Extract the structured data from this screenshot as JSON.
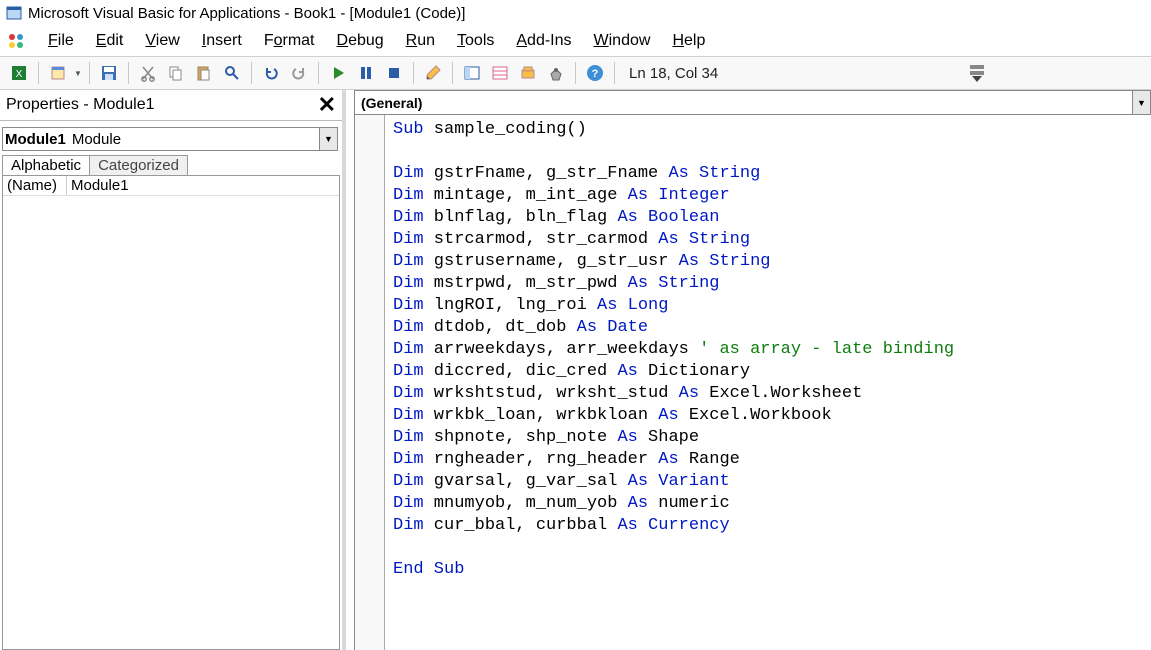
{
  "title": "Microsoft Visual Basic for Applications - Book1 - [Module1 (Code)]",
  "menu": {
    "file": "File",
    "edit": "Edit",
    "view": "View",
    "insert": "Insert",
    "format": "Format",
    "debug": "Debug",
    "run": "Run",
    "tools": "Tools",
    "addins": "Add-Ins",
    "window": "Window",
    "help": "Help"
  },
  "toolbar": {
    "cursor_status": "Ln 18, Col 34"
  },
  "properties": {
    "title": "Properties - Module1",
    "object_name": "Module1",
    "object_type": "Module",
    "tab_alpha": "Alphabetic",
    "tab_cat": "Categorized",
    "rows": [
      {
        "k": "(Name)",
        "v": "Module1"
      }
    ]
  },
  "code_header": {
    "left_combo": "(General)"
  },
  "code_lines": [
    {
      "tokens": [
        {
          "t": "Sub",
          "c": "kw"
        },
        {
          "t": " sample_coding()",
          "c": ""
        }
      ]
    },
    {
      "tokens": []
    },
    {
      "tokens": [
        {
          "t": "Dim",
          "c": "kw"
        },
        {
          "t": " gstrFname, g_str_Fname ",
          "c": ""
        },
        {
          "t": "As String",
          "c": "kw"
        }
      ]
    },
    {
      "tokens": [
        {
          "t": "Dim",
          "c": "kw"
        },
        {
          "t": " mintage, m_int_age ",
          "c": ""
        },
        {
          "t": "As Integer",
          "c": "kw"
        }
      ]
    },
    {
      "tokens": [
        {
          "t": "Dim",
          "c": "kw"
        },
        {
          "t": " blnflag, bln_flag ",
          "c": ""
        },
        {
          "t": "As Boolean",
          "c": "kw"
        }
      ]
    },
    {
      "tokens": [
        {
          "t": "Dim",
          "c": "kw"
        },
        {
          "t": " strcarmod, str_carmod ",
          "c": ""
        },
        {
          "t": "As String",
          "c": "kw"
        }
      ]
    },
    {
      "tokens": [
        {
          "t": "Dim",
          "c": "kw"
        },
        {
          "t": " gstrusername, g_str_usr ",
          "c": ""
        },
        {
          "t": "As String",
          "c": "kw"
        }
      ]
    },
    {
      "tokens": [
        {
          "t": "Dim",
          "c": "kw"
        },
        {
          "t": " mstrpwd, m_str_pwd ",
          "c": ""
        },
        {
          "t": "As String",
          "c": "kw"
        }
      ]
    },
    {
      "tokens": [
        {
          "t": "Dim",
          "c": "kw"
        },
        {
          "t": " lngROI, lng_roi ",
          "c": ""
        },
        {
          "t": "As Long",
          "c": "kw"
        }
      ]
    },
    {
      "tokens": [
        {
          "t": "Dim",
          "c": "kw"
        },
        {
          "t": " dtdob, dt_dob ",
          "c": ""
        },
        {
          "t": "As Date",
          "c": "kw"
        }
      ]
    },
    {
      "tokens": [
        {
          "t": "Dim",
          "c": "kw"
        },
        {
          "t": " arrweekdays, arr_weekdays ",
          "c": ""
        },
        {
          "t": "' as array - late binding",
          "c": "cm"
        }
      ]
    },
    {
      "tokens": [
        {
          "t": "Dim",
          "c": "kw"
        },
        {
          "t": " diccred, dic_cred ",
          "c": ""
        },
        {
          "t": "As",
          "c": "kw"
        },
        {
          "t": " Dictionary",
          "c": ""
        }
      ]
    },
    {
      "tokens": [
        {
          "t": "Dim",
          "c": "kw"
        },
        {
          "t": " wrkshtstud, wrksht_stud ",
          "c": ""
        },
        {
          "t": "As",
          "c": "kw"
        },
        {
          "t": " Excel.Worksheet",
          "c": ""
        }
      ]
    },
    {
      "tokens": [
        {
          "t": "Dim",
          "c": "kw"
        },
        {
          "t": " wrkbk_loan, wrkbkloan ",
          "c": ""
        },
        {
          "t": "As",
          "c": "kw"
        },
        {
          "t": " Excel.Workbook",
          "c": ""
        }
      ]
    },
    {
      "tokens": [
        {
          "t": "Dim",
          "c": "kw"
        },
        {
          "t": " shpnote, shp_note ",
          "c": ""
        },
        {
          "t": "As",
          "c": "kw"
        },
        {
          "t": " Shape",
          "c": ""
        }
      ]
    },
    {
      "tokens": [
        {
          "t": "Dim",
          "c": "kw"
        },
        {
          "t": " rngheader, rng_header ",
          "c": ""
        },
        {
          "t": "As",
          "c": "kw"
        },
        {
          "t": " Range",
          "c": ""
        }
      ]
    },
    {
      "tokens": [
        {
          "t": "Dim",
          "c": "kw"
        },
        {
          "t": " gvarsal, g_var_sal ",
          "c": ""
        },
        {
          "t": "As Variant",
          "c": "kw"
        }
      ]
    },
    {
      "tokens": [
        {
          "t": "Dim",
          "c": "kw"
        },
        {
          "t": " mnumyob, m_num_yob ",
          "c": ""
        },
        {
          "t": "As",
          "c": "kw"
        },
        {
          "t": " numeric",
          "c": ""
        }
      ]
    },
    {
      "tokens": [
        {
          "t": "Dim",
          "c": "kw"
        },
        {
          "t": " cur_bbal, curbbal ",
          "c": ""
        },
        {
          "t": "As Currency",
          "c": "kw"
        }
      ]
    },
    {
      "tokens": []
    },
    {
      "tokens": [
        {
          "t": "End Sub",
          "c": "kw"
        }
      ]
    }
  ]
}
